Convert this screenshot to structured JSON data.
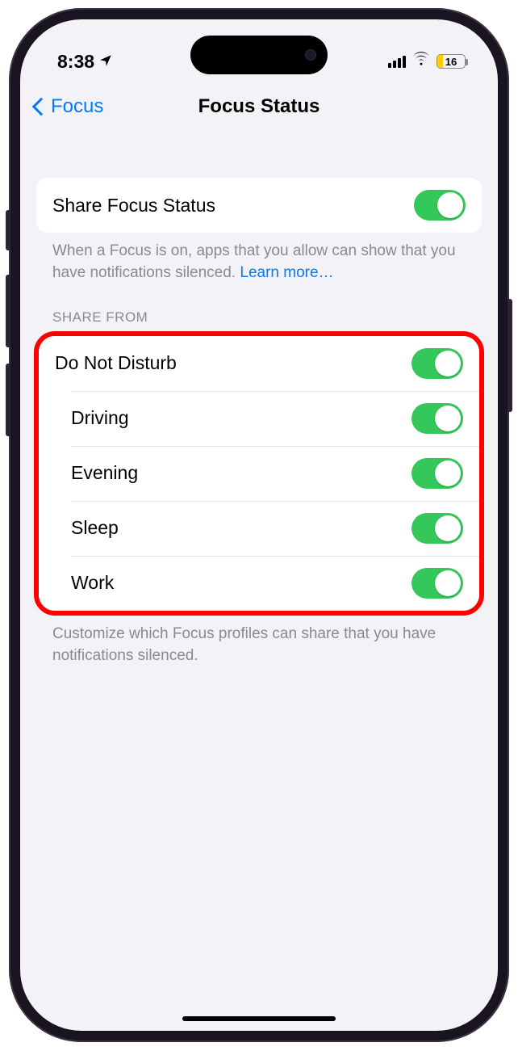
{
  "status": {
    "time": "8:38",
    "battery_pct": "16"
  },
  "nav": {
    "back_label": "Focus",
    "title": "Focus Status"
  },
  "share_group": {
    "label": "Share Focus Status",
    "footer_text": "When a Focus is on, apps that you allow can show that you have notifications silenced. ",
    "learn_more": "Learn more…"
  },
  "share_from": {
    "header": "Share From",
    "items": [
      {
        "label": "Do Not Disturb"
      },
      {
        "label": "Driving"
      },
      {
        "label": "Evening"
      },
      {
        "label": "Sleep"
      },
      {
        "label": "Work"
      }
    ],
    "footer": "Customize which Focus profiles can share that you have notifications silenced."
  }
}
